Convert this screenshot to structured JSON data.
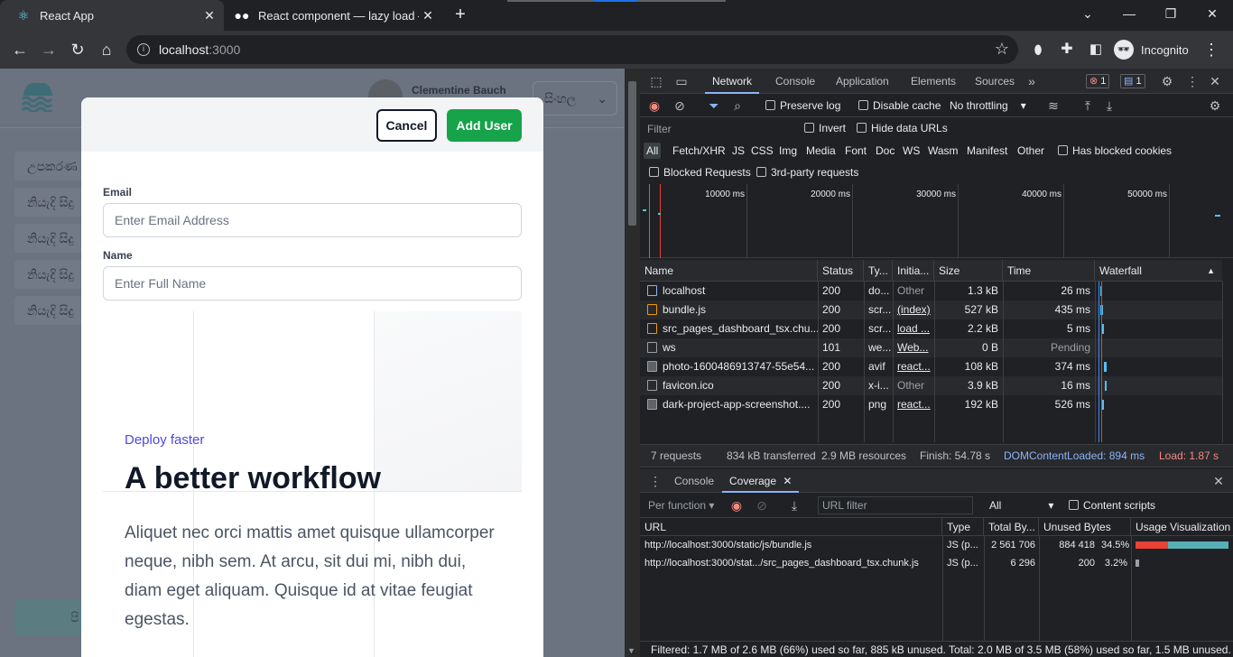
{
  "browser": {
    "tabs": [
      {
        "title": "React App",
        "icon": "react-icon",
        "active": true
      },
      {
        "title": "React component — lazy load —",
        "icon": "medium-icon",
        "active": false
      }
    ],
    "url_host": "localhost",
    "url_port": ":3000",
    "profile_label": "Incognito"
  },
  "app": {
    "user_name": "Clementine Bauch",
    "language": "සිංහල",
    "sidebar_items": [
      "උපකරණ",
      "නියැදි සිදු",
      "නියැදි සිදු",
      "නියැදි සිදු",
      "නියැදි සිදු"
    ],
    "bottom_button": "පි",
    "modal": {
      "cancel_label": "Cancel",
      "add_label": "Add User",
      "email_label": "Email",
      "email_placeholder": "Enter Email Address",
      "name_label": "Name",
      "name_placeholder": "Enter Full Name",
      "eyebrow": "Deploy faster",
      "headline": "A better workflow",
      "body": "Aliquet nec orci mattis amet quisque ullamcorper neque, nibh sem. At arcu, sit dui mi, nibh dui, diam eget aliquam. Quisque id at vitae feugiat egestas."
    }
  },
  "devtools": {
    "tabs": [
      "Network",
      "Console",
      "Application",
      "Elements",
      "Sources"
    ],
    "active_tab": "Network",
    "errors": "1",
    "messages": "1",
    "preserve_log": "Preserve log",
    "disable_cache": "Disable cache",
    "throttling": "No throttling",
    "filter_placeholder": "Filter",
    "invert": "Invert",
    "hide_data_urls": "Hide data URLs",
    "type_filters": [
      "All",
      "Fetch/XHR",
      "JS",
      "CSS",
      "Img",
      "Media",
      "Font",
      "Doc",
      "WS",
      "Wasm",
      "Manifest",
      "Other"
    ],
    "has_blocked_cookies": "Has blocked cookies",
    "blocked_requests": "Blocked Requests",
    "third_party": "3rd-party requests",
    "timeline_labels": [
      "10000 ms",
      "20000 ms",
      "30000 ms",
      "40000 ms",
      "50000 ms"
    ],
    "columns": [
      "Name",
      "Status",
      "Ty...",
      "Initia...",
      "Size",
      "Time",
      "Waterfall"
    ],
    "rows": [
      {
        "name": "localhost",
        "status": "200",
        "type": "do...",
        "initiator": "Other",
        "size": "1.3 kB",
        "time": "26 ms",
        "icon": "doc"
      },
      {
        "name": "bundle.js",
        "status": "200",
        "type": "scr...",
        "initiator": "(index)",
        "size": "527 kB",
        "time": "435 ms",
        "icon": "js"
      },
      {
        "name": "src_pages_dashboard_tsx.chu...",
        "status": "200",
        "type": "scr...",
        "initiator": "load ...",
        "size": "2.2 kB",
        "time": "5 ms",
        "icon": "js"
      },
      {
        "name": "ws",
        "status": "101",
        "type": "we...",
        "initiator": "Web...",
        "size": "0 B",
        "time": "Pending",
        "icon": "none"
      },
      {
        "name": "photo-1600486913747-55e54...",
        "status": "200",
        "type": "avif",
        "initiator": "react...",
        "size": "108 kB",
        "time": "374 ms",
        "icon": "img"
      },
      {
        "name": "favicon.ico",
        "status": "200",
        "type": "x-i...",
        "initiator": "Other",
        "size": "3.9 kB",
        "time": "16 ms",
        "icon": "none"
      },
      {
        "name": "dark-project-app-screenshot....",
        "status": "200",
        "type": "png",
        "initiator": "react...",
        "size": "192 kB",
        "time": "526 ms",
        "icon": "img"
      }
    ],
    "status": {
      "requests": "7 requests",
      "transferred": "834 kB transferred",
      "resources": "2.9 MB resources",
      "finish": "Finish: 54.78 s",
      "dcl": "DOMContentLoaded: 894 ms",
      "load": "Load: 1.87 s"
    },
    "drawer_tabs": [
      "Console",
      "Coverage"
    ],
    "coverage": {
      "per_function": "Per function",
      "url_filter_placeholder": "URL filter",
      "type_select": "All",
      "content_scripts": "Content scripts",
      "columns": [
        "URL",
        "Type",
        "Total By...",
        "Unused Bytes",
        "Usage Visualization"
      ],
      "rows": [
        {
          "url": "http://localhost:3000/static/js/bundle.js",
          "type": "JS (p...",
          "total": "2 561 706",
          "unused": "884 418",
          "pct": "34.5%",
          "unused_fraction": 0.345
        },
        {
          "url": "http://localhost:3000/stat.../src_pages_dashboard_tsx.chunk.js",
          "type": "JS (p...",
          "total": "6 296",
          "unused": "200",
          "pct": "3.2%",
          "unused_fraction": 0.032
        }
      ],
      "footer": "Filtered: 1.7 MB of 2.6 MB (66%) used so far, 885 kB unused. Total: 2.0 MB of 3.5 MB (58%) used so far, 1.5 MB unused."
    }
  },
  "colors": {
    "accent_green": "#16a34a",
    "accent_indigo": "#4f46e5",
    "devtools_blue": "#8ab4f8"
  }
}
